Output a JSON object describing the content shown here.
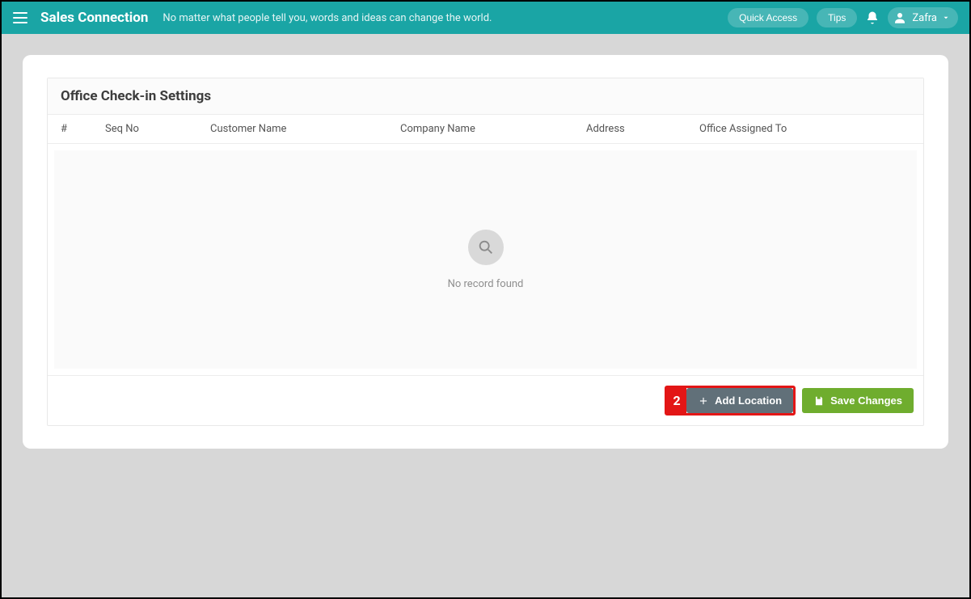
{
  "header": {
    "brand": "Sales Connection",
    "tagline": "No matter what people tell you, words and ideas can change the world.",
    "quick_access": "Quick Access",
    "tips": "Tips",
    "user_name": "Zafra"
  },
  "panel": {
    "title": "Office Check-in Settings",
    "columns": {
      "index": "#",
      "seq": "Seq No",
      "customer": "Customer Name",
      "company": "Company Name",
      "address": "Address",
      "assigned": "Office Assigned To"
    },
    "empty_text": "No record found"
  },
  "callout": {
    "number": "2"
  },
  "buttons": {
    "add_location": "Add Location",
    "save_changes": "Save Changes"
  }
}
